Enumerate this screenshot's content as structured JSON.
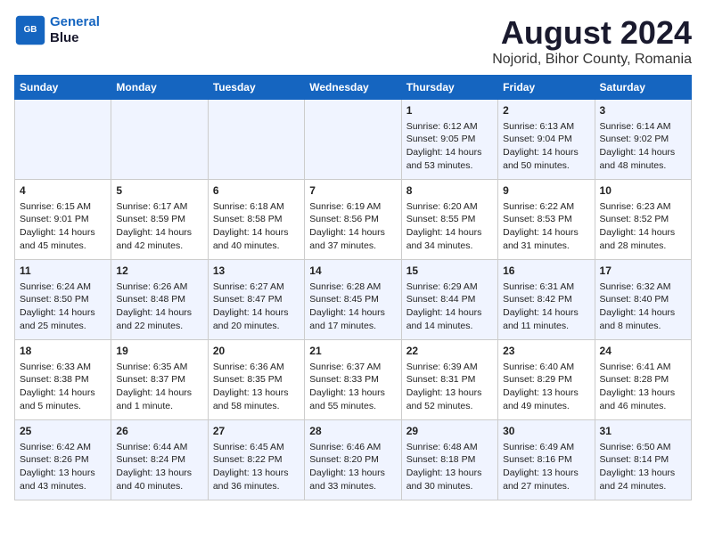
{
  "header": {
    "logo_line1": "General",
    "logo_line2": "Blue",
    "main_title": "August 2024",
    "subtitle": "Nojorid, Bihor County, Romania"
  },
  "weekdays": [
    "Sunday",
    "Monday",
    "Tuesday",
    "Wednesday",
    "Thursday",
    "Friday",
    "Saturday"
  ],
  "weeks": [
    [
      {
        "day": "",
        "info": ""
      },
      {
        "day": "",
        "info": ""
      },
      {
        "day": "",
        "info": ""
      },
      {
        "day": "",
        "info": ""
      },
      {
        "day": "1",
        "info": "Sunrise: 6:12 AM\nSunset: 9:05 PM\nDaylight: 14 hours\nand 53 minutes."
      },
      {
        "day": "2",
        "info": "Sunrise: 6:13 AM\nSunset: 9:04 PM\nDaylight: 14 hours\nand 50 minutes."
      },
      {
        "day": "3",
        "info": "Sunrise: 6:14 AM\nSunset: 9:02 PM\nDaylight: 14 hours\nand 48 minutes."
      }
    ],
    [
      {
        "day": "4",
        "info": "Sunrise: 6:15 AM\nSunset: 9:01 PM\nDaylight: 14 hours\nand 45 minutes."
      },
      {
        "day": "5",
        "info": "Sunrise: 6:17 AM\nSunset: 8:59 PM\nDaylight: 14 hours\nand 42 minutes."
      },
      {
        "day": "6",
        "info": "Sunrise: 6:18 AM\nSunset: 8:58 PM\nDaylight: 14 hours\nand 40 minutes."
      },
      {
        "day": "7",
        "info": "Sunrise: 6:19 AM\nSunset: 8:56 PM\nDaylight: 14 hours\nand 37 minutes."
      },
      {
        "day": "8",
        "info": "Sunrise: 6:20 AM\nSunset: 8:55 PM\nDaylight: 14 hours\nand 34 minutes."
      },
      {
        "day": "9",
        "info": "Sunrise: 6:22 AM\nSunset: 8:53 PM\nDaylight: 14 hours\nand 31 minutes."
      },
      {
        "day": "10",
        "info": "Sunrise: 6:23 AM\nSunset: 8:52 PM\nDaylight: 14 hours\nand 28 minutes."
      }
    ],
    [
      {
        "day": "11",
        "info": "Sunrise: 6:24 AM\nSunset: 8:50 PM\nDaylight: 14 hours\nand 25 minutes."
      },
      {
        "day": "12",
        "info": "Sunrise: 6:26 AM\nSunset: 8:48 PM\nDaylight: 14 hours\nand 22 minutes."
      },
      {
        "day": "13",
        "info": "Sunrise: 6:27 AM\nSunset: 8:47 PM\nDaylight: 14 hours\nand 20 minutes."
      },
      {
        "day": "14",
        "info": "Sunrise: 6:28 AM\nSunset: 8:45 PM\nDaylight: 14 hours\nand 17 minutes."
      },
      {
        "day": "15",
        "info": "Sunrise: 6:29 AM\nSunset: 8:44 PM\nDaylight: 14 hours\nand 14 minutes."
      },
      {
        "day": "16",
        "info": "Sunrise: 6:31 AM\nSunset: 8:42 PM\nDaylight: 14 hours\nand 11 minutes."
      },
      {
        "day": "17",
        "info": "Sunrise: 6:32 AM\nSunset: 8:40 PM\nDaylight: 14 hours\nand 8 minutes."
      }
    ],
    [
      {
        "day": "18",
        "info": "Sunrise: 6:33 AM\nSunset: 8:38 PM\nDaylight: 14 hours\nand 5 minutes."
      },
      {
        "day": "19",
        "info": "Sunrise: 6:35 AM\nSunset: 8:37 PM\nDaylight: 14 hours\nand 1 minute."
      },
      {
        "day": "20",
        "info": "Sunrise: 6:36 AM\nSunset: 8:35 PM\nDaylight: 13 hours\nand 58 minutes."
      },
      {
        "day": "21",
        "info": "Sunrise: 6:37 AM\nSunset: 8:33 PM\nDaylight: 13 hours\nand 55 minutes."
      },
      {
        "day": "22",
        "info": "Sunrise: 6:39 AM\nSunset: 8:31 PM\nDaylight: 13 hours\nand 52 minutes."
      },
      {
        "day": "23",
        "info": "Sunrise: 6:40 AM\nSunset: 8:29 PM\nDaylight: 13 hours\nand 49 minutes."
      },
      {
        "day": "24",
        "info": "Sunrise: 6:41 AM\nSunset: 8:28 PM\nDaylight: 13 hours\nand 46 minutes."
      }
    ],
    [
      {
        "day": "25",
        "info": "Sunrise: 6:42 AM\nSunset: 8:26 PM\nDaylight: 13 hours\nand 43 minutes."
      },
      {
        "day": "26",
        "info": "Sunrise: 6:44 AM\nSunset: 8:24 PM\nDaylight: 13 hours\nand 40 minutes."
      },
      {
        "day": "27",
        "info": "Sunrise: 6:45 AM\nSunset: 8:22 PM\nDaylight: 13 hours\nand 36 minutes."
      },
      {
        "day": "28",
        "info": "Sunrise: 6:46 AM\nSunset: 8:20 PM\nDaylight: 13 hours\nand 33 minutes."
      },
      {
        "day": "29",
        "info": "Sunrise: 6:48 AM\nSunset: 8:18 PM\nDaylight: 13 hours\nand 30 minutes."
      },
      {
        "day": "30",
        "info": "Sunrise: 6:49 AM\nSunset: 8:16 PM\nDaylight: 13 hours\nand 27 minutes."
      },
      {
        "day": "31",
        "info": "Sunrise: 6:50 AM\nSunset: 8:14 PM\nDaylight: 13 hours\nand 24 minutes."
      }
    ]
  ]
}
